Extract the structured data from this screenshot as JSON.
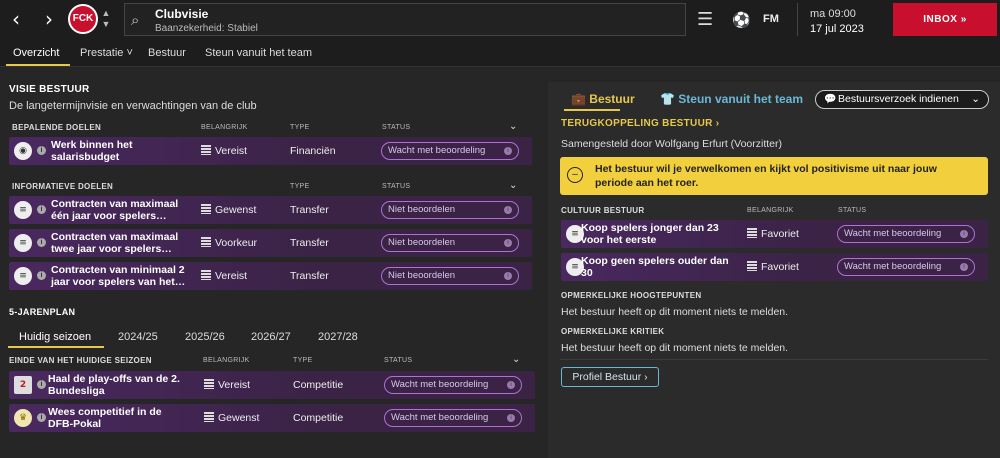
{
  "topbar": {
    "back": "‹",
    "forward": "›",
    "club_logo_text": "FCK",
    "title": "Clubvisie",
    "subtitle": "Baanzekerheid: Stabiel",
    "fm_label": "FM",
    "time": "ma 09:00",
    "date": "17 jul 2023",
    "inbox_label": "INBOX"
  },
  "subnav": {
    "tabs": [
      {
        "label": "Overzicht"
      },
      {
        "label": "Prestatie ˅"
      },
      {
        "label": "Bestuur"
      },
      {
        "label": "Steun vanuit het team"
      }
    ]
  },
  "visie": {
    "title": "VISIE BESTUUR",
    "subtitle": "De langetermijnvisie en verwachtingen van de club",
    "bepalend": {
      "header": "BEPALENDE DOELEN",
      "col_imp": "BELANGRIJK",
      "col_type": "TYPE",
      "col_status": "STATUS",
      "rows": [
        {
          "name": "Werk binnen het salarisbudget",
          "imp": "Vereist",
          "type": "Financiën",
          "status": "Wacht met beoordeling"
        }
      ]
    },
    "informatief": {
      "header": "INFORMATIEVE DOELEN",
      "col_type": "TYPE",
      "col_status": "STATUS",
      "rows": [
        {
          "name": "Contracten van maximaal één jaar voor spelers…",
          "imp": "Gewenst",
          "type": "Transfer",
          "status": "Niet beoordelen"
        },
        {
          "name": "Contracten van maximaal twee jaar voor spelers…",
          "imp": "Voorkeur",
          "type": "Transfer",
          "status": "Niet beoordelen"
        },
        {
          "name": "Contracten van minimaal 2 jaar voor spelers van het…",
          "imp": "Vereist",
          "type": "Transfer",
          "status": "Niet beoordelen"
        }
      ]
    }
  },
  "plan": {
    "title": "5-JARENPLAN",
    "years": [
      {
        "label": "Huidig seizoen"
      },
      {
        "label": "2024/25"
      },
      {
        "label": "2025/26"
      },
      {
        "label": "2026/27"
      },
      {
        "label": "2027/28"
      }
    ],
    "header": "EINDE VAN HET HUIDIGE SEIZOEN",
    "col_imp": "BELANGRIJK",
    "col_type": "TYPE",
    "col_status": "STATUS",
    "rows": [
      {
        "name": "Haal de play-offs van de 2. Bundesliga",
        "imp": "Vereist",
        "type": "Competitie",
        "status": "Wacht met beoordeling"
      },
      {
        "name": "Wees competitief in de DFB-Pokal",
        "imp": "Gewenst",
        "type": "Competitie",
        "status": "Wacht met beoordeling"
      }
    ]
  },
  "right": {
    "tab_bestuur": "Bestuur",
    "tab_steun": "Steun vanuit het team",
    "verzoek_label": "Bestuursverzoek indienen",
    "feedback_title": "TERUGKOPPELING BESTUUR ›",
    "composed_by": "Samengesteld door Wolfgang Erfurt (Voorzitter)",
    "yellow_message": "Het bestuur wil je verwelkomen en kijkt vol positivisme uit naar jouw periode aan het roer.",
    "cultuur": {
      "header": "CULTUUR BESTUUR",
      "col_imp": "BELANGRIJK",
      "col_status": "STATUS",
      "rows": [
        {
          "name": "Koop spelers jonger dan 23 voor het eerste",
          "imp": "Favoriet",
          "status": "Wacht met beoordeling"
        },
        {
          "name": "Koop geen spelers ouder dan 30",
          "imp": "Favoriet",
          "status": "Wacht met beoordeling"
        }
      ]
    },
    "highlights_title": "OPMERKELIJKE HOOGTEPUNTEN",
    "highlights_text": "Het bestuur heeft op dit moment niets te melden.",
    "critique_title": "OPMERKELIJKE KRITIEK",
    "critique_text": "Het bestuur heeft op dit moment niets te melden.",
    "profile_button": "Profiel Bestuur ›"
  },
  "colors": {
    "accent_gold": "#e6c84a",
    "inbox_red": "#c8102e",
    "row_purple": "#4a2860",
    "status_border": "#b070d8",
    "steun_blue": "#6ab8d8",
    "message_yellow": "#f2cf3c"
  }
}
